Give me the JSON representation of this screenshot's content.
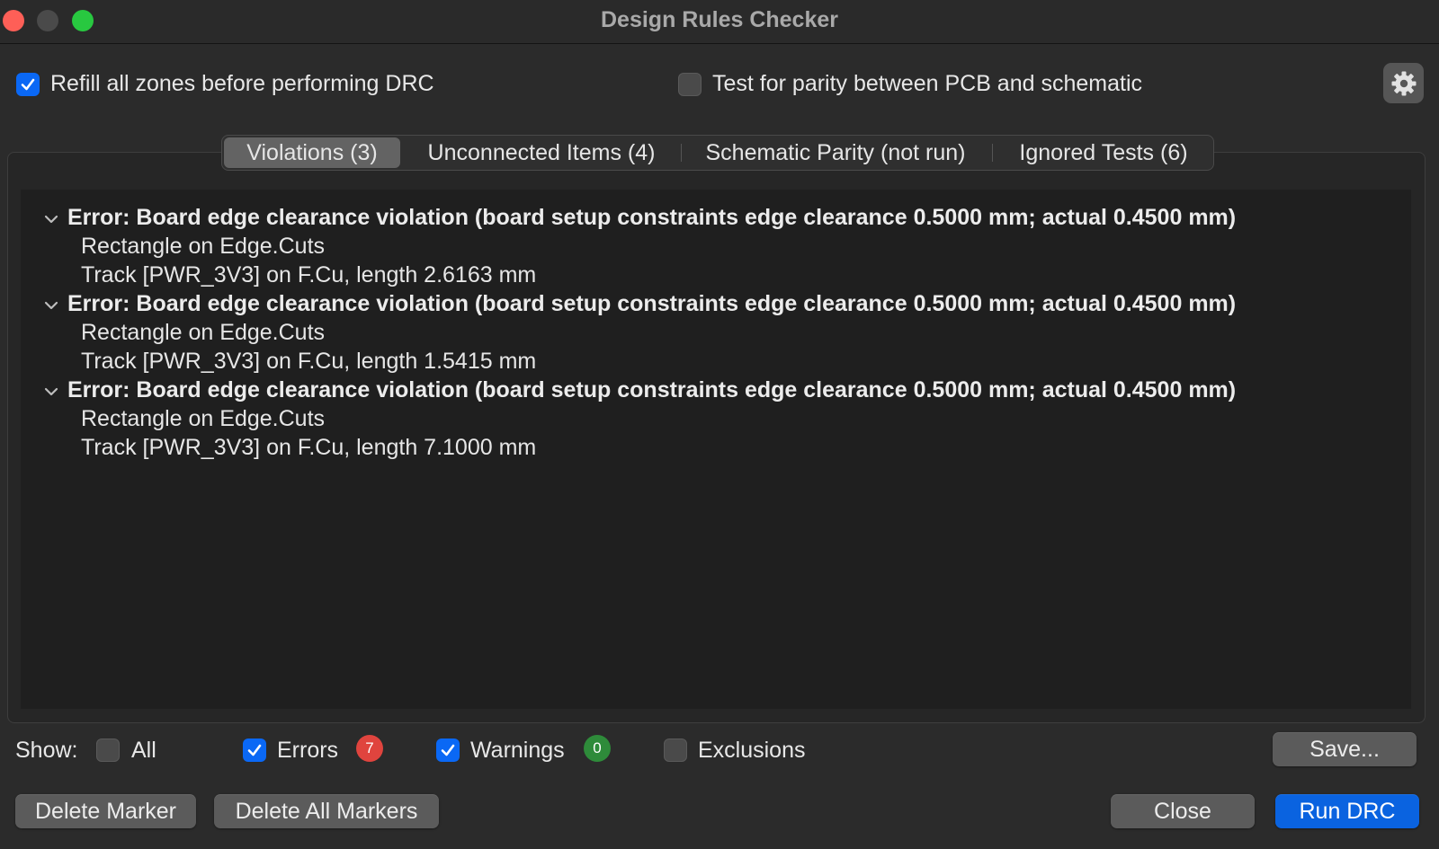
{
  "window": {
    "title": "Design Rules Checker"
  },
  "options": {
    "refill_zones": {
      "label": "Refill all zones before performing DRC",
      "checked": true
    },
    "test_parity": {
      "label": "Test for parity between PCB and schematic",
      "checked": false
    }
  },
  "tabs": [
    {
      "label": "Violations (3)",
      "active": true
    },
    {
      "label": "Unconnected Items (4)",
      "active": false
    },
    {
      "label": "Schematic Parity (not run)",
      "active": false
    },
    {
      "label": "Ignored Tests (6)",
      "active": false
    }
  ],
  "violations": [
    {
      "title": "Error: Board edge clearance violation (board setup constraints edge clearance 0.5000 mm; actual 0.4500 mm)",
      "items": [
        "Rectangle on Edge.Cuts",
        "Track [PWR_3V3] on F.Cu, length 2.6163 mm"
      ]
    },
    {
      "title": "Error: Board edge clearance violation (board setup constraints edge clearance 0.5000 mm; actual 0.4500 mm)",
      "items": [
        "Rectangle on Edge.Cuts",
        "Track [PWR_3V3] on F.Cu, length 1.5415 mm"
      ]
    },
    {
      "title": "Error: Board edge clearance violation (board setup constraints edge clearance 0.5000 mm; actual 0.4500 mm)",
      "items": [
        "Rectangle on Edge.Cuts",
        "Track [PWR_3V3] on F.Cu, length 7.1000 mm"
      ]
    }
  ],
  "filters": {
    "show_label": "Show:",
    "all": {
      "label": "All",
      "checked": false
    },
    "errors": {
      "label": "Errors",
      "checked": true,
      "count": "7"
    },
    "warnings": {
      "label": "Warnings",
      "checked": true,
      "count": "0"
    },
    "exclusions": {
      "label": "Exclusions",
      "checked": false
    }
  },
  "buttons": {
    "save": "Save...",
    "delete_marker": "Delete Marker",
    "delete_all_markers": "Delete All Markers",
    "close": "Close",
    "run_drc": "Run DRC"
  },
  "colors": {
    "accent": "#0a68f5",
    "error_badge": "#e0443e",
    "warning_badge": "#2e8b3a"
  }
}
